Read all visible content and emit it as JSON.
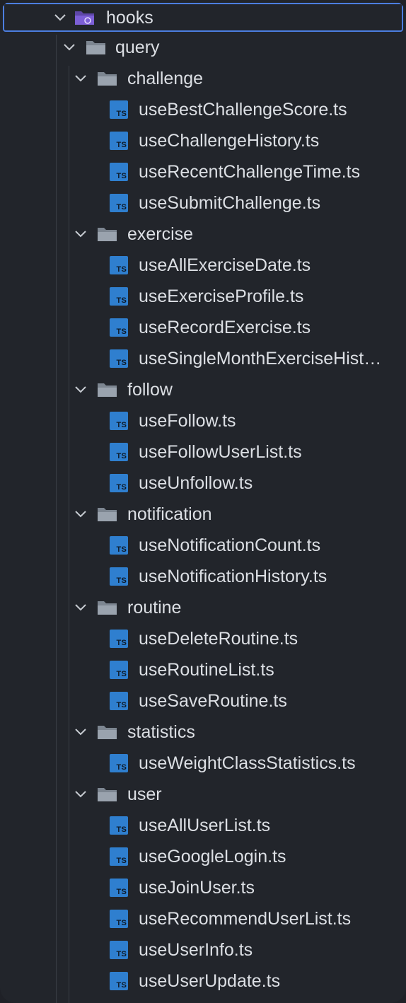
{
  "tree": {
    "root": {
      "label": "hooks",
      "icon": "hooks-folder-icon"
    },
    "query": {
      "label": "query",
      "icon": "folder-open-icon"
    },
    "folders": [
      {
        "label": "challenge",
        "files": [
          "useBestChallengeScore.ts",
          "useChallengeHistory.ts",
          "useRecentChallengeTime.ts",
          "useSubmitChallenge.ts"
        ]
      },
      {
        "label": "exercise",
        "files": [
          "useAllExerciseDate.ts",
          "useExerciseProfile.ts",
          "useRecordExercise.ts",
          "useSingleMonthExerciseHist…"
        ]
      },
      {
        "label": "follow",
        "files": [
          "useFollow.ts",
          "useFollowUserList.ts",
          "useUnfollow.ts"
        ]
      },
      {
        "label": "notification",
        "files": [
          "useNotificationCount.ts",
          "useNotificationHistory.ts"
        ]
      },
      {
        "label": "routine",
        "files": [
          "useDeleteRoutine.ts",
          "useRoutineList.ts",
          "useSaveRoutine.ts"
        ]
      },
      {
        "label": "statistics",
        "files": [
          "useWeightClassStatistics.ts"
        ]
      },
      {
        "label": "user",
        "files": [
          "useAllUserList.ts",
          "useGoogleLogin.ts",
          "useJoinUser.ts",
          "useRecommendUserList.ts",
          "useUserInfo.ts",
          "useUserUpdate.ts"
        ]
      }
    ],
    "file_badge": "TS"
  },
  "colors": {
    "background": "#22252b",
    "text": "#dcdfe4",
    "selection_border": "#4c7ee0",
    "ts_icon": "#2f7fcf",
    "hooks_folder": "#7c5fd6",
    "folder": "#9aa3ae"
  }
}
